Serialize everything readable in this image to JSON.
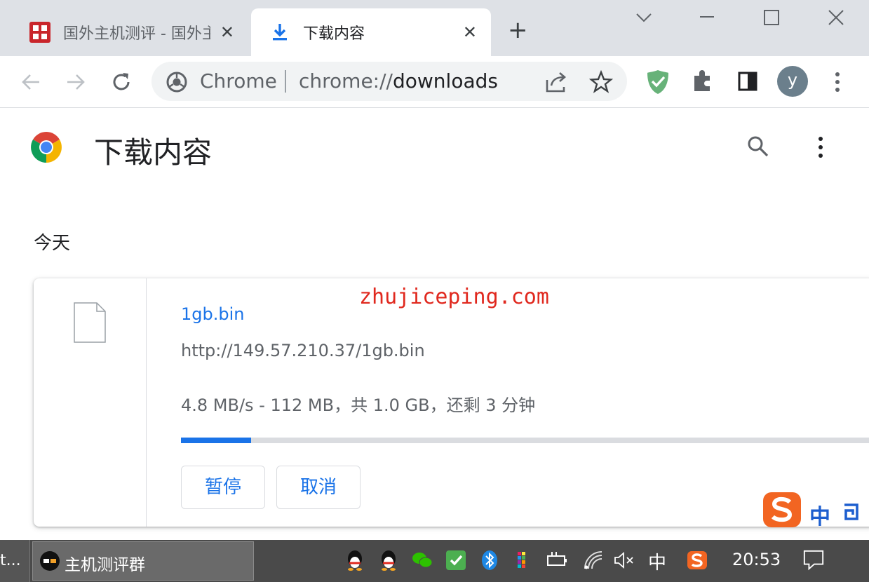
{
  "tabs": [
    {
      "title": "国外主机测评 - 国外主机测评",
      "active": false
    },
    {
      "title": "下载内容",
      "active": true
    }
  ],
  "omnibox": {
    "site_label": "Chrome",
    "url_scheme": "chrome://",
    "url_path": "downloads"
  },
  "profile": {
    "initial": "y"
  },
  "page": {
    "title": "下载内容",
    "date_header": "今天"
  },
  "download": {
    "filename": "1gb.bin",
    "url": "http://149.57.210.37/1gb.bin",
    "status": "4.8 MB/s - 112 MB，共 1.0 GB，还剩 3 分钟",
    "progress_fraction": 0.102,
    "pause_label": "暂停",
    "cancel_label": "取消"
  },
  "watermark": "zhujiceping.com",
  "ime": {
    "lang": "中"
  },
  "taskbar": {
    "left_label": "t...",
    "app_label": "主机测评群",
    "input_lang": "中",
    "clock": "20:53"
  },
  "colors": {
    "accent": "#1a73e8",
    "tabstrip": "#dee1e6",
    "watermark": "#e0281e",
    "taskbar": "#4a4a4a"
  }
}
